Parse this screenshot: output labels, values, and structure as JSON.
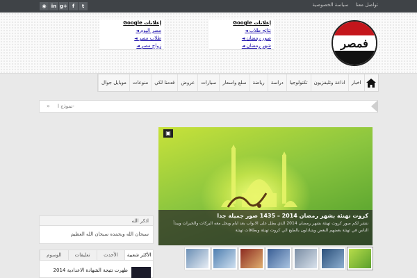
{
  "topbar": {
    "links": [
      "تواصل معنا",
      "سياسة الخصوصية"
    ],
    "social": [
      {
        "icon": "twitter-icon",
        "glyph": "t"
      },
      {
        "icon": "facebook-icon",
        "glyph": "f"
      },
      {
        "icon": "google-plus-icon",
        "glyph": "g+"
      },
      {
        "icon": "linkedin-icon",
        "glyph": "in"
      },
      {
        "icon": "rss-icon",
        "glyph": "◉"
      }
    ]
  },
  "logo": {
    "text": "فمصر"
  },
  "ads": [
    {
      "title": "إعلانات Google",
      "links": [
        "نتائج طلاب",
        "صور رمضان",
        "شهر رمضان"
      ]
    },
    {
      "title": "إعلانات Google",
      "links": [
        "مصر اليوم",
        "طلاب مصر",
        "زواج مصر"
      ]
    }
  ],
  "nav": {
    "items": [
      "اخبار",
      "اذاعة وتليفزيون",
      "تكنولوجيا",
      "دراسة",
      "رياضة",
      "سلع واسعار",
      "سيارات",
      "عروض",
      "قدمنا لكي",
      "منوعات",
      "موبايل جوال"
    ]
  },
  "ticker": {
    "text": "نموذج ا-",
    "arrow": "»"
  },
  "featured": {
    "gallery_icon": "▣",
    "title": "كروت تهنئة بشهر رمضان 2014 – 1435 صور جميلة جدا",
    "excerpt": "ننشر لكم صور كروت تهنئة بشهر رمضان 2014 الذي يطل على الابواب بعد ايام ويحل معه البركات والخيرات ويبدأ الناس في تهنئة بعضهم البعض ويتبادلون بالطبع الي كروت تهنئة وبطاقات تهنئة"
  },
  "thumbs": [
    {
      "color": "#7ac143"
    },
    {
      "color": "#2f5d8a"
    },
    {
      "color": "#a8b7c8"
    },
    {
      "color": "#4a6fa5"
    },
    {
      "color": "#c0392b"
    },
    {
      "color": "#6f8fb5"
    },
    {
      "color": "#8aa9c9"
    }
  ],
  "widget": {
    "title": "اذكر الله",
    "body": "سبحان الله وبحمده سبحان الله العظيم"
  },
  "tabs": {
    "items": [
      "الأكثر شعبية",
      "الأحدث",
      "تعليقات",
      "الوسوم"
    ],
    "post_title": "ظهرت نتيجة الشهادة الاعدادية 2014"
  }
}
